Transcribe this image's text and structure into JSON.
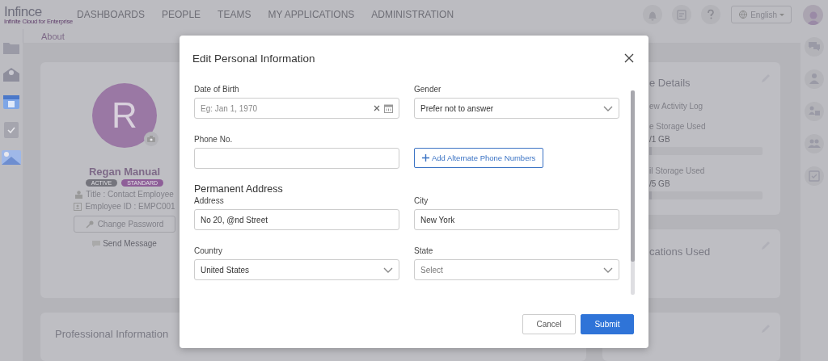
{
  "nav": {
    "logo": "Infince",
    "tagline": "Infinite Cloud for Enterprise",
    "items": [
      "DASHBOARDS",
      "PEOPLE",
      "TEAMS",
      "MY APPLICATIONS",
      "ADMINISTRATION"
    ],
    "language": "English"
  },
  "page": {
    "breadcrumb": "About",
    "profile": {
      "initial": "R",
      "name": "Regan Manual",
      "badges": [
        {
          "label": "ACTIVE",
          "color": "#74747c"
        },
        {
          "label": "STANDARD",
          "color": "#8e5e98"
        }
      ],
      "title": "Title : Contact Employee",
      "employee_id": "Employee ID : EMPC001",
      "change_password": "Change Password",
      "send_message": "Send Message"
    },
    "professional_heading": "Professional Information",
    "details_card": {
      "title": "e Details",
      "link": "ew Activity Log",
      "meters": [
        {
          "label": "e Storage Used",
          "reading": "/1 GB",
          "level": 0.02
        },
        {
          "label": "il Storage Used",
          "reading": "/5 GB",
          "level": 0.02
        }
      ]
    },
    "apps_card": {
      "title": "cations Used"
    }
  },
  "modal": {
    "title": "Edit Personal Information",
    "fields": [
      {
        "kind": "date",
        "label": "Date of Birth",
        "placeholder": "Eg: Jan 1, 1970"
      },
      {
        "kind": "select",
        "label": "Gender",
        "value": "Prefer not to answer"
      },
      {
        "kind": "text",
        "label": "Phone No."
      },
      {
        "kind": "button",
        "label": "Add Alternate Phone Numbers"
      },
      {
        "kind": "heading",
        "label": "Permanent Address"
      },
      {
        "kind": "text",
        "label": "Address",
        "value": "No 20, @nd Street"
      },
      {
        "kind": "text",
        "label": "City",
        "value": "New York"
      },
      {
        "kind": "select",
        "label": "Country",
        "value": "United States"
      },
      {
        "kind": "select",
        "label": "State",
        "placeholder": "Select"
      }
    ],
    "buttons": [
      {
        "kind": "secondary",
        "label": "Cancel"
      },
      {
        "kind": "primary",
        "label": "Submit"
      }
    ]
  }
}
